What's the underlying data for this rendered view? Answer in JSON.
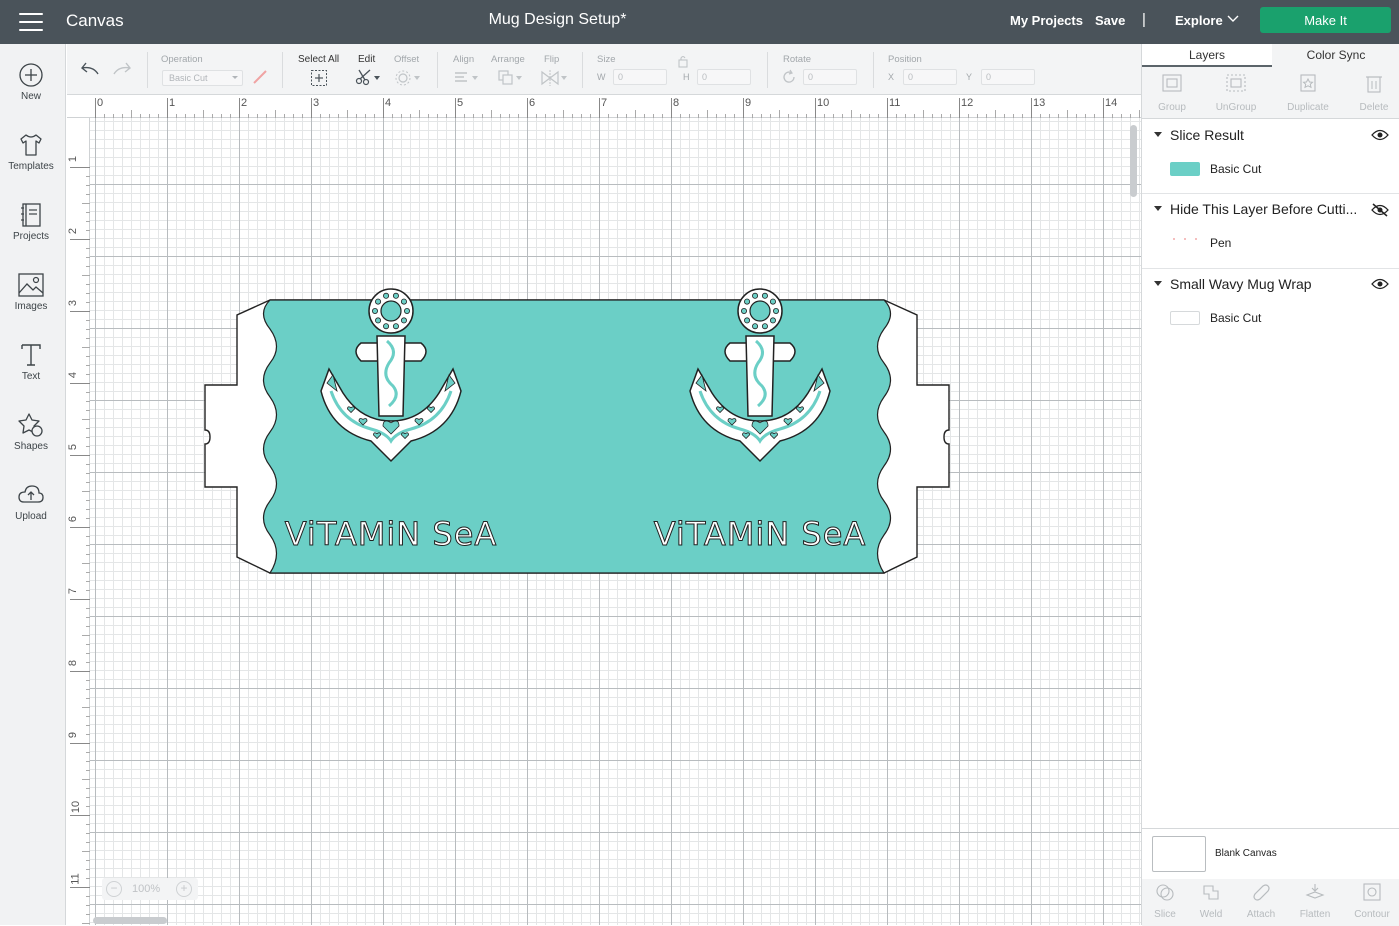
{
  "topbar": {
    "app_title": "Canvas",
    "doc_title": "Mug Design Setup*",
    "my_projects": "My Projects",
    "save": "Save",
    "separator": "|",
    "explore": "Explore",
    "make_it": "Make It"
  },
  "sidebar": {
    "items": [
      {
        "label": "New",
        "icon": "plus-circle-icon"
      },
      {
        "label": "Templates",
        "icon": "tshirt-icon"
      },
      {
        "label": "Projects",
        "icon": "book-icon"
      },
      {
        "label": "Images",
        "icon": "image-icon"
      },
      {
        "label": "Text",
        "icon": "text-icon"
      },
      {
        "label": "Shapes",
        "icon": "shapes-icon"
      },
      {
        "label": "Upload",
        "icon": "upload-cloud-icon"
      }
    ]
  },
  "toolbar": {
    "operation_label": "Operation",
    "operation_value": "Basic Cut",
    "select_all": "Select All",
    "edit": "Edit",
    "offset": "Offset",
    "align": "Align",
    "arrange": "Arrange",
    "flip": "Flip",
    "size": "Size",
    "w_label": "W",
    "w_value": "0",
    "h_label": "H",
    "h_value": "0",
    "rotate": "Rotate",
    "rotate_value": "0",
    "position": "Position",
    "x_label": "X",
    "x_value": "0",
    "y_label": "Y",
    "y_value": "0"
  },
  "canvas": {
    "ruler_top": [
      "0",
      "1",
      "2",
      "3",
      "4",
      "5",
      "6",
      "7",
      "8",
      "9",
      "10",
      "11",
      "12",
      "13",
      "14"
    ],
    "ruler_left": [
      "1",
      "2",
      "3",
      "4",
      "5",
      "6",
      "7",
      "8",
      "9",
      "10",
      "11"
    ],
    "zoom": "100%",
    "zoom_minus": "−",
    "zoom_plus": "+",
    "design_text": "ViTAMiN SeA",
    "design_color": "#6bcfc6"
  },
  "panel": {
    "tabs": [
      "Layers",
      "Color Sync"
    ],
    "actions": [
      "Group",
      "UnGroup",
      "Duplicate",
      "Delete"
    ],
    "layers": [
      {
        "title": "Slice Result",
        "sub": "Basic Cut",
        "visible": true,
        "swatch": "#6bcfc6"
      },
      {
        "title": "Hide This Layer Before Cutti...",
        "sub": "Pen",
        "visible": false,
        "swatch": "#f2c6c6"
      },
      {
        "title": "Small Wavy Mug Wrap",
        "sub": "Basic Cut",
        "visible": true,
        "swatch": "#ffffff"
      }
    ],
    "blank_canvas": "Blank Canvas",
    "bottom_actions": [
      "Slice",
      "Weld",
      "Attach",
      "Flatten",
      "Contour"
    ]
  }
}
